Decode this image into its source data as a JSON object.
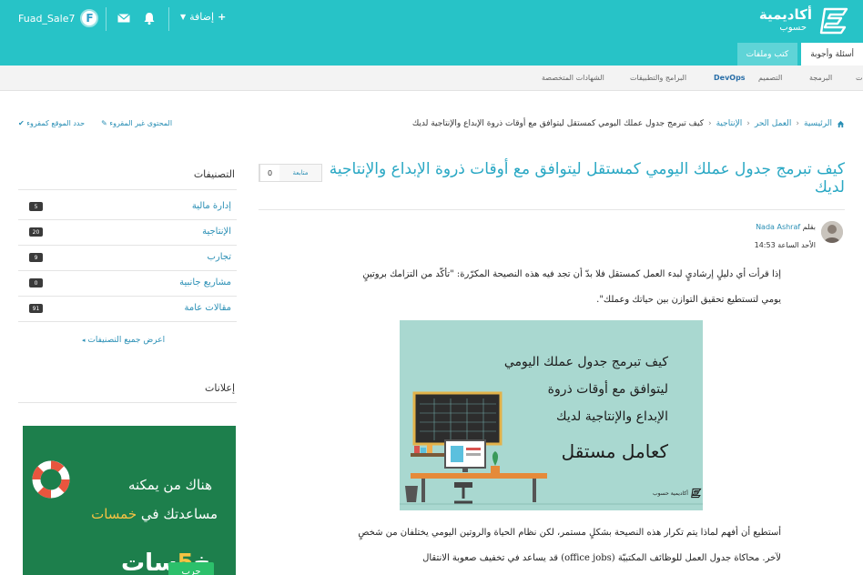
{
  "header": {
    "logo_title": "أكاديمية",
    "logo_subtitle": "حسوب",
    "username": "Fuad_Sale7",
    "avatar_letter": "F",
    "add_label": "إضافة"
  },
  "main_tabs": [
    {
      "label": "أسئلة وأجوبة"
    },
    {
      "label": "كتب وملفات"
    }
  ],
  "subnav": [
    "البرمجة",
    "التصميم",
    "DevOps",
    "البرامج والتطبيقات",
    "الشهادات المتخصصة"
  ],
  "breadcrumb": {
    "home": "الرئيسية",
    "section": "العمل الحر",
    "category": "الإنتاجية",
    "current": "كيف تبرمج جدول عملك اليومي كمستقل ليتوافق مع أوقات ذروة الإبداع والإنتاجية لديك"
  },
  "tools": {
    "unread": "المحتوى غير المقروء",
    "mark_read": "حدد الموقع كمقروء"
  },
  "article": {
    "title": "كيف تبرمج جدول عملك اليومي كمستقل ليتوافق مع أوقات ذروة الإبداع والإنتاجية لديك",
    "follow_label": "متابعة",
    "follow_count": "0",
    "by_prefix": "بقلم",
    "author": "Nada Ashraf",
    "date": "الأحد الساعة 14:53",
    "para1": "إذا قرأت أي دليلٍ إرشاديٍ لبدء العمل كمستقل فلا بدّ أن تجد فيه هذه النصيحة المكرّرة: \"تأكّد من التزامك بروتينٍ يومي لتستطيع تحقيق التوازن بين حياتك وعملك\".",
    "image_lines": [
      "كيف تبرمج جدول عملك اليومي",
      "ليتوافق مع أوقات ذروة",
      "الإبداع والإنتاجية لديك",
      "كعامل مستقل"
    ],
    "image_brand": "أكاديمية حسوب",
    "para2": "أستطيع أن أفهم لماذا يتم تكرار هذه النصيحة بشكلٍ مستمر، لكن نظام الحياة والروتين اليومي يختلفان من شخصٍ لآخر. محاكاة جدول العمل للوظائف المكتبيّة (office jobs) قد يساعد في تخفيف صعوبة الانتقال"
  },
  "sidebar": {
    "categories_heading": "التصنيفات",
    "categories": [
      {
        "label": "إدارة مالية",
        "count": "5"
      },
      {
        "label": "الإنتاجية",
        "count": "20"
      },
      {
        "label": "تجارب",
        "count": "9"
      },
      {
        "label": "مشاريع جانبية",
        "count": "0"
      },
      {
        "label": "مقالات عامة",
        "count": "91"
      }
    ],
    "all_categories": "اعرض جميع التصنيفات",
    "ads_heading": "إعلانات",
    "ad": {
      "line1": "هناك من يمكنه",
      "line2_prefix": "مساعدتك في",
      "line2_brand": "خمسات",
      "logo_a": "خ",
      "logo_b": "5",
      "logo_c": "سات",
      "button": "جرب"
    }
  },
  "colors": {
    "header": "#27c3c7",
    "link": "#2a8fb5",
    "title": "#2aa8c4",
    "ad_bg": "#1d7f4c",
    "ad_highlight": "#f6c343"
  }
}
